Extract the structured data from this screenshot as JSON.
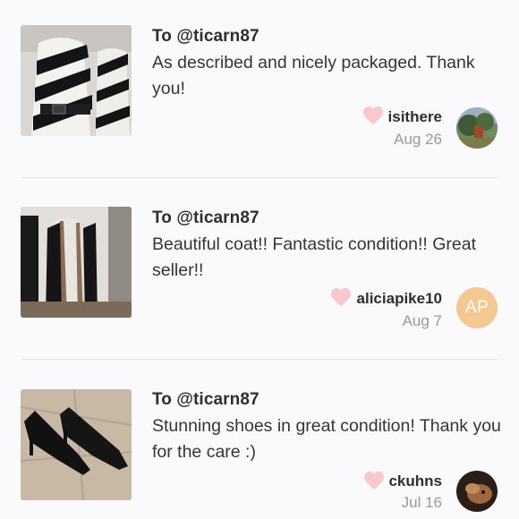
{
  "colors": {
    "background": "#faf9fb",
    "heart": "#f7c9cf",
    "initials_avatar": "#f3c892",
    "muted_text": "#9a98a0",
    "divider": "#e3e1e5"
  },
  "reviews": [
    {
      "to": "To @ticarn87",
      "comment": "As described and nicely packaged. Thank you!",
      "username": "isithere",
      "date": "Aug 26",
      "icon": "heart-icon",
      "item_image": "black-white-striped-dress-photo",
      "avatar": "photo-avatar"
    },
    {
      "to": "To @ticarn87",
      "comment": "Beautiful coat!! Fantastic condition!! Great seller!!",
      "username": "aliciapike10",
      "date": "Aug 7",
      "icon": "heart-icon",
      "item_image": "long-coat-photo",
      "avatar_initials": "AP"
    },
    {
      "to": "To @ticarn87",
      "comment": "Stunning shoes in great condition! Thank you for the care :)",
      "username": "ckuhns",
      "date": "Jul 16",
      "icon": "heart-icon",
      "item_image": "black-pumps-photo",
      "avatar": "photo-avatar"
    }
  ]
}
